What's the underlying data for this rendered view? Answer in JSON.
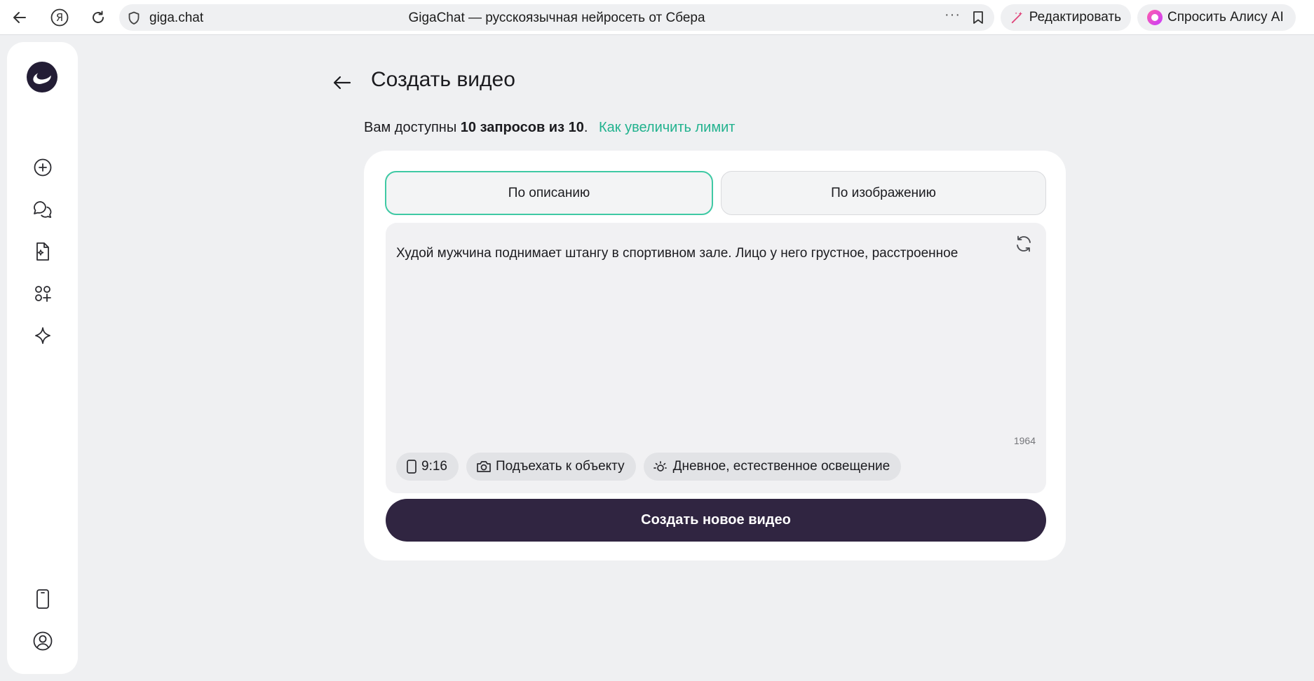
{
  "browser": {
    "ya_label": "Я",
    "url": "giga.chat",
    "tab_title": "GigaChat — русскоязычная нейросеть от Сбера",
    "more_label": "···",
    "edit_label": "Редактировать",
    "alice_label": "Спросить Алису AI"
  },
  "sidebar": {
    "items": [
      "new-chat",
      "chats",
      "files",
      "apps",
      "features"
    ],
    "bottom": [
      "mobile-app",
      "profile"
    ]
  },
  "main": {
    "title": "Создать видео",
    "limit_prefix": "Вам доступны",
    "limit_value": "10 запросов из 10",
    "limit_suffix": ".",
    "limit_link": "Как увеличить лимит",
    "tabs": {
      "description": "По описанию",
      "image": "По изображению"
    },
    "prompt_text": "Худой мужчина поднимает штангу в спортивном зале. Лицо у него грустное, расстроенное",
    "char_count": "1964",
    "chips": {
      "ratio": "9:16",
      "camera": "Подъехать к объекту",
      "lighting": "Дневное, естественное освещение"
    },
    "create_button": "Создать новое видео"
  },
  "colors": {
    "accent": "#21b28e",
    "tab_border": "#3fc9a4",
    "primary_button": "#302541",
    "background": "#eff0f2"
  }
}
